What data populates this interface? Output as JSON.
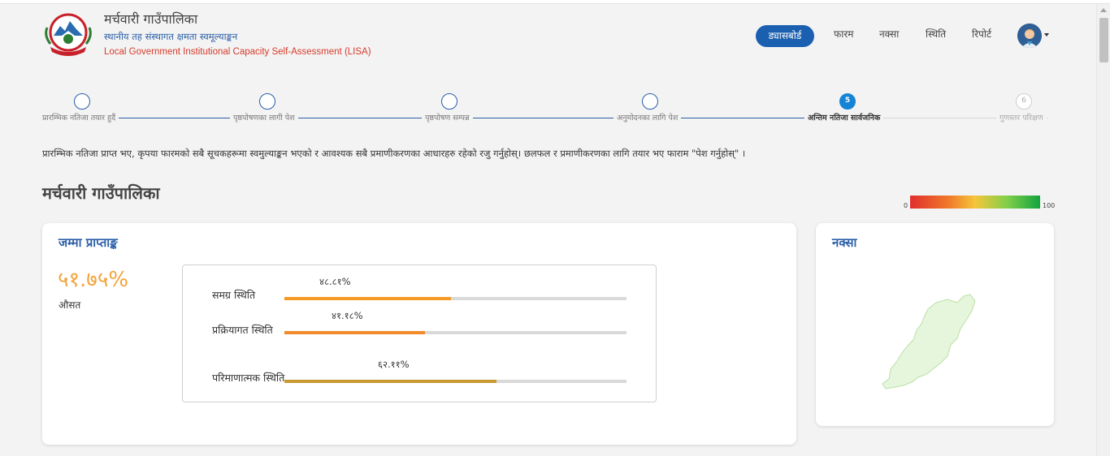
{
  "header": {
    "title": "मर्चवारी गाउँपालिका",
    "subtitle_np": "स्थानीय तह संस्थागत क्षमता स्वमूल्याङ्कन",
    "subtitle_en": "Local Government Institutional Capacity Self-Assessment (LISA)",
    "logo_icon": "nepal-emblem-icon"
  },
  "nav": {
    "dashboard": "ड्यासबोर्ड",
    "form": "फारम",
    "map": "नक्सा",
    "status": "स्थिति",
    "report": "रिपोर्ट",
    "avatar_icon": "user-avatar-icon"
  },
  "stepper": {
    "steps": [
      {
        "label": "प्रारम्भिक नतिजा तयार हुदैं",
        "number": ""
      },
      {
        "label": "पृष्ठपोषणका लागी पेश",
        "number": ""
      },
      {
        "label": "पृष्ठपोषण सम्पन्न",
        "number": ""
      },
      {
        "label": "अनुमोदनका लागि पेश",
        "number": ""
      },
      {
        "label": "अन्तिम नतिजा सार्वजनिक",
        "number": "5"
      },
      {
        "label": "गुणस्तर परिक्षण",
        "number": "6"
      }
    ]
  },
  "instruction": "प्रारम्भिक नतिजा प्राप्त भए, कृपया फारमको सबै सूचकहरूमा स्वमुल्याङ्कन भएको र आवश्यक सबै प्रमाणीकरणका आधारहरु रहेको रजु गर्नुहोस्। छलफल र प्रमाणीकरणका लागि तयार भए फाराम \"पेश गर्नुहोस्\" ।",
  "page_title": "मर्चवारी गाउँपालिका",
  "legend": {
    "min": "0",
    "max": "100"
  },
  "score_card": {
    "title": "जम्मा प्राप्ताङ्क",
    "score": "५१.७५%",
    "score_label": "औसत",
    "bars": [
      {
        "label": "समग्र स्थिति",
        "value_text": "४८.८१%",
        "value": 48.81,
        "color": "#f49a25"
      },
      {
        "label": "प्रक्रियागत स्थिति",
        "value_text": "४१.१८%",
        "value": 41.18,
        "color": "#f08a2a"
      },
      {
        "label": "परिमाणात्मक स्थिति",
        "value_text": "६२.११%",
        "value": 62.11,
        "color": "#c99a32"
      }
    ]
  },
  "map_card": {
    "title": "नक्सा",
    "map_color": "#e6f6dc"
  }
}
